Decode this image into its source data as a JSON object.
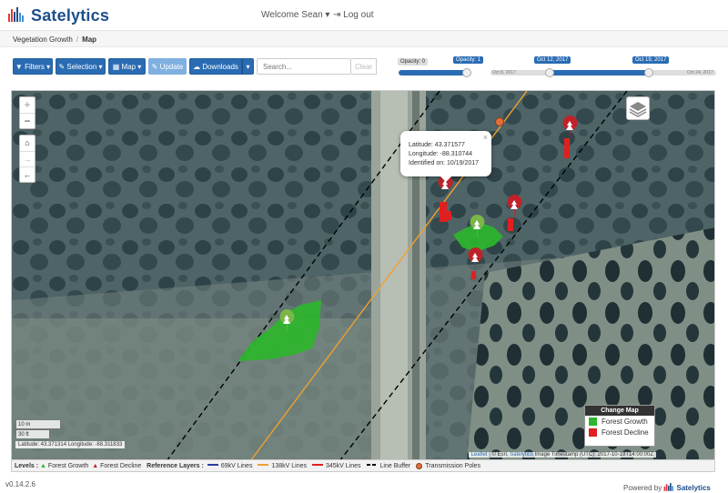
{
  "header": {
    "brand": "Satelytics",
    "welcome": "Welcome Sean",
    "logout": "Log out"
  },
  "breadcrumb": {
    "parent": "Vegetation Growth",
    "current": "Map"
  },
  "toolbar": {
    "filters": "Filters",
    "selection": "Selection",
    "map": "Map",
    "update": "Update",
    "downloads": "Downloads",
    "search_placeholder": "Search...",
    "clear": "Clear"
  },
  "opacity_slider": {
    "label_left": "Opacity: 0",
    "label_right": "Opacity: 1",
    "value": 1
  },
  "date_slider": {
    "min_label": "Oct 8, 2017",
    "max_label": "Oct 24, 2017",
    "start_label": "Oct 12, 2017",
    "end_label": "Oct 19, 2017"
  },
  "map_controls": {
    "zoom_in": "+",
    "zoom_out": "−"
  },
  "popup": {
    "latitude": "Latitude: 43.371577",
    "longitude": "Longitude: -88.310744",
    "identified": "Identified on: 10/19/2017",
    "close": "×"
  },
  "change_map_legend": {
    "title": "Change Map",
    "items": [
      {
        "label": "Forest Growth",
        "color": "#2db52d"
      },
      {
        "label": "Forest Decline",
        "color": "#e02020"
      }
    ]
  },
  "scale": {
    "metric": "10 m",
    "imperial": "30 ft"
  },
  "cursor_coords": "Latitude: 43.371314 Longitude: -88.311833",
  "attribution": {
    "leaflet": "Leaflet",
    "esri": "© Esri,",
    "satelytics": "Satelytics",
    "timestamp": "Image Timestamp (UTC): 2017-10-19T14:00:00Z"
  },
  "level_bar": {
    "levels_label": "Levels :",
    "forest_growth": "Forest Growth",
    "forest_decline": "Forest Decline",
    "reference_label": "Reference Layers :",
    "lines": [
      {
        "label": "69kV Lines",
        "color": "#2a3f9e"
      },
      {
        "label": "138kV Lines",
        "color": "#f0a030"
      },
      {
        "label": "345kV Lines",
        "color": "#e02020"
      },
      {
        "label": "Line Buffer",
        "color": "#000000"
      }
    ],
    "poles": "Transmission Poles"
  },
  "footer": {
    "version": "v0.14.2.6",
    "powered_by": "Powered by",
    "brand": "Satelytics"
  }
}
